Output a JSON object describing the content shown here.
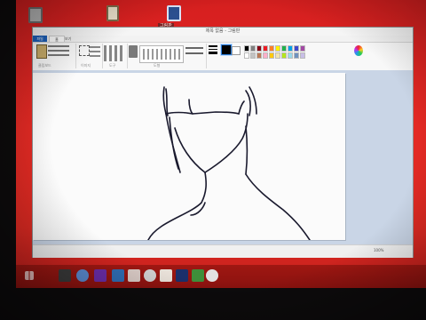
{
  "desktop": {
    "icons": [
      {
        "icon": "recycle-bin-icon",
        "label": ""
      },
      {
        "icon": "library-icon",
        "label": ""
      },
      {
        "icon": "paint-shortcut-icon",
        "label": "그림판"
      }
    ]
  },
  "window": {
    "title": "제목 없음 - 그림판",
    "tabs": {
      "file": "파일",
      "home": "홈",
      "view": "보기"
    }
  },
  "ribbon": {
    "groups": [
      "클립보드",
      "이미지",
      "도구",
      "브러시",
      "도형",
      "크기",
      "색 1",
      "색 2",
      "색 편집"
    ],
    "colors": {
      "color1": "#000000",
      "color2": "#ffffff",
      "palette": [
        "#000000",
        "#7f7f7f",
        "#880015",
        "#ed1c24",
        "#ff7f27",
        "#fff200",
        "#22b14c",
        "#00a2e8",
        "#3f48cc",
        "#a349a4",
        "#ffffff",
        "#c3c3c3",
        "#b97a57",
        "#ffaec9",
        "#ffc90e",
        "#efe4b0",
        "#b5e61d",
        "#99d9ea",
        "#7092be",
        "#c8bfe7"
      ]
    }
  },
  "status": {
    "position": "",
    "size": "",
    "zoom": "100%"
  }
}
